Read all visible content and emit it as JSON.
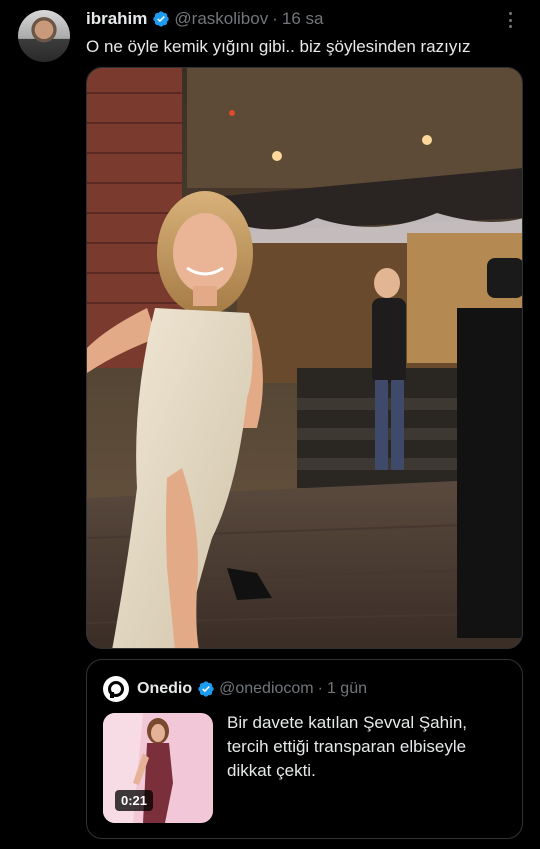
{
  "tweet": {
    "author_name": "ibrahim",
    "author_handle": "@raskolibov",
    "separator": "·",
    "time": "16 sa",
    "text": "O ne öyle kemik yığını gibi.. biz şöylesinden razıyız",
    "verified_color": "#1d9bf0"
  },
  "quote": {
    "source_name": "Onedio",
    "source_handle": "@onediocom",
    "separator": "·",
    "time": "1 gün",
    "text": "Bir davete katılan Şevval Şahin, tercih ettiği transparan elbiseyle dikkat çekti.",
    "video_duration": "0:21"
  },
  "icons": {
    "verified": "verified-badge-icon",
    "more": "more-options-icon",
    "onedio_logo": "onedio-logo-icon"
  }
}
